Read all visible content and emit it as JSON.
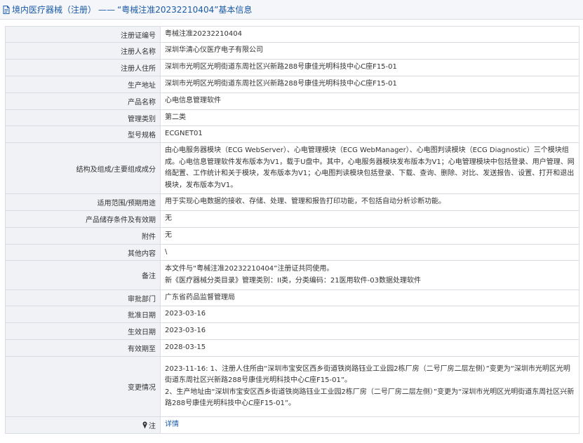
{
  "header": {
    "category": "境内医疗器械（注册）",
    "separator": "——",
    "title": "“粤械注准20232210404”基本信息"
  },
  "rows": [
    {
      "label": "注册证编号",
      "value": "粤械注准20232210404"
    },
    {
      "label": "注册人名称",
      "value": "深圳华清心仪医疗电子有限公司"
    },
    {
      "label": "注册人住所",
      "value": "深圳市光明区光明街道东周社区兴新路288号康佳光明科技中心C座F15-01"
    },
    {
      "label": "生产地址",
      "value": "深圳市光明区光明街道东周社区兴新路288号康佳光明科技中心C座F15-01"
    },
    {
      "label": "产品名称",
      "value": "心电信息管理软件"
    },
    {
      "label": "管理类别",
      "value": "第二类"
    },
    {
      "label": "型号规格",
      "value": "ECGNET01"
    },
    {
      "label": "结构及组成/主要组成成分",
      "value": "由心电服务器模块（ECG WebServer）、心电管理模块（ECG WebManager）、心电图判读模块（ECG Diagnostic）三个模块组成。心电信息管理软件发布版本为V1，载于U盘中。其中，心电服务器模块发布版本为V1；心电管理模块中包括登录、用户管理、网络配置、工作统计和关于模块，发布版本为V1；心电图判读模块包括登录、下载、查询、删除、对比、发送报告、设置、打开和退出模块，发布版本为V1。"
    },
    {
      "label": "适用范围/预期用途",
      "value": "用于实现心电数据的接收、存储、处理、管理和报告打印功能，不包括自动分析诊断功能。"
    },
    {
      "label": "产品储存条件及有效期",
      "value": "无"
    },
    {
      "label": "附件",
      "value": "无"
    },
    {
      "label": "其他内容",
      "value": "\\"
    },
    {
      "label": "备注",
      "value_lines": [
        "本文件与“粤械注准20232210404”注册证共同使用。",
        "新《医疗器械分类目录》管理类别：II类，分类编码：21医用软件-03数据处理软件"
      ]
    },
    {
      "label": "审批部门",
      "value": "广东省药品监督管理局"
    },
    {
      "label": "批准日期",
      "value": "2023-03-16"
    },
    {
      "label": "生效日期",
      "value": "2023-03-16"
    },
    {
      "label": "有效期至",
      "value": "2028-03-15"
    },
    {
      "label": "变更情况",
      "value_lines": [
        "2023-11-16: 1、注册人住所由“深圳市宝安区西乡街道铁岗路钰业工业园2栋厂房（二号厂房二层左侧）”变更为“深圳市光明区光明街道东周社区兴新路288号康佳光明科技中心C座F15-01”。",
        "2、生产地址由“深圳市宝安区西乡街道铁岗路钰业工业园2栋厂房（二号厂房二层左侧）”变更为“深圳市光明区光明街道东周社区兴新路288号康佳光明科技中心C座F15-01”。"
      ]
    },
    {
      "label": "注",
      "link": "详情"
    }
  ],
  "icons": {
    "header": "document-icon",
    "note": "pin-icon"
  }
}
